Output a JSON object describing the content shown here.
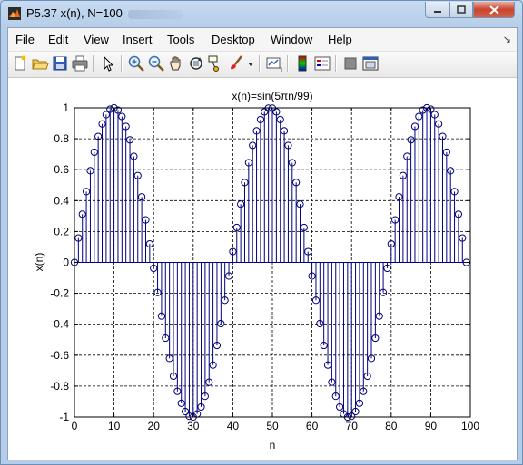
{
  "window": {
    "title": "P5.37 x(n), N=100"
  },
  "menu": [
    "File",
    "Edit",
    "View",
    "Insert",
    "Tools",
    "Desktop",
    "Window",
    "Help"
  ],
  "toolbar": [
    "new-figure-icon",
    "open-file-icon",
    "save-icon",
    "print-icon",
    "pointer-icon",
    "zoom-in-icon",
    "zoom-out-icon",
    "pan-icon",
    "rotate-3d-icon",
    "data-cursor-icon",
    "brush-icon",
    "link-plot-icon",
    "colorbar-icon",
    "legend-icon",
    "hide-plot-tools-icon",
    "show-plot-tools-icon"
  ],
  "colors": {
    "stem": "#00007f",
    "close": "#c8452f"
  },
  "chart_data": {
    "type": "stem",
    "title": "x(n)=sin(5πn/99)",
    "xlabel": "n",
    "ylabel": "x(n)",
    "xlim": [
      0,
      100
    ],
    "ylim": [
      -1,
      1
    ],
    "xticks": [
      "0",
      "10",
      "20",
      "30",
      "40",
      "50",
      "60",
      "70",
      "80",
      "90",
      "100"
    ],
    "yticks": [
      "1",
      "0.8",
      "0.6",
      "0.4",
      "0.2",
      "0",
      "-0.2",
      "-0.4",
      "-0.6",
      "-0.8",
      "-1"
    ],
    "grid": true,
    "n": [
      0,
      1,
      2,
      3,
      4,
      5,
      6,
      7,
      8,
      9,
      10,
      11,
      12,
      13,
      14,
      15,
      16,
      17,
      18,
      19,
      20,
      21,
      22,
      23,
      24,
      25,
      26,
      27,
      28,
      29,
      30,
      31,
      32,
      33,
      34,
      35,
      36,
      37,
      38,
      39,
      40,
      41,
      42,
      43,
      44,
      45,
      46,
      47,
      48,
      49,
      50,
      51,
      52,
      53,
      54,
      55,
      56,
      57,
      58,
      59,
      60,
      61,
      62,
      63,
      64,
      65,
      66,
      67,
      68,
      69,
      70,
      71,
      72,
      73,
      74,
      75,
      76,
      77,
      78,
      79,
      80,
      81,
      82,
      83,
      84,
      85,
      86,
      87,
      88,
      89,
      90,
      91,
      92,
      93,
      94,
      95,
      96,
      97,
      98,
      99
    ],
    "values": [
      0.0,
      0.158,
      0.312,
      0.458,
      0.593,
      0.713,
      0.815,
      0.896,
      0.956,
      0.991,
      1.0,
      0.985,
      0.944,
      0.88,
      0.793,
      0.686,
      0.562,
      0.424,
      0.275,
      0.12,
      -0.038,
      -0.195,
      -0.347,
      -0.49,
      -0.621,
      -0.736,
      -0.834,
      -0.911,
      -0.965,
      -0.995,
      -1.0,
      -0.98,
      -0.935,
      -0.866,
      -0.775,
      -0.664,
      -0.537,
      -0.396,
      -0.245,
      -0.088,
      0.07,
      0.226,
      0.377,
      0.517,
      0.645,
      0.757,
      0.851,
      0.924,
      0.974,
      0.998,
      0.998,
      0.974,
      0.924,
      0.851,
      0.757,
      0.645,
      0.517,
      0.377,
      0.226,
      0.07,
      -0.088,
      -0.245,
      -0.396,
      -0.537,
      -0.664,
      -0.775,
      -0.866,
      -0.935,
      -0.98,
      -1.0,
      -0.995,
      -0.965,
      -0.911,
      -0.834,
      -0.736,
      -0.621,
      -0.49,
      -0.347,
      -0.195,
      -0.038,
      0.12,
      0.275,
      0.424,
      0.562,
      0.686,
      0.793,
      0.88,
      0.944,
      0.985,
      1.0,
      0.991,
      0.956,
      0.896,
      0.815,
      0.713,
      0.593,
      0.458,
      0.312,
      0.158,
      0.0
    ]
  }
}
